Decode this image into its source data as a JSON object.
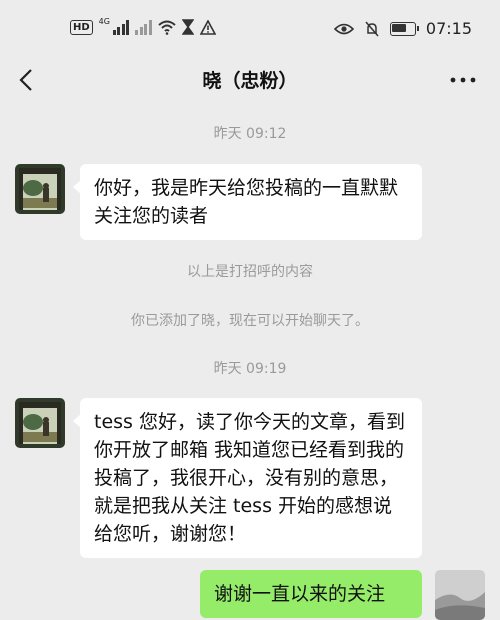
{
  "status_bar": {
    "hd_label": "HD",
    "network_label": "4G",
    "time": "07:15",
    "battery_level": 0.72
  },
  "header": {
    "title": "晓（忠粉）"
  },
  "messages": [
    {
      "type": "timestamp",
      "text": "昨天 09:12"
    },
    {
      "type": "incoming",
      "text": "你好，我是昨天给您投稿的一直默默关注您的读者"
    },
    {
      "type": "system",
      "text": "以上是打招呼的内容"
    },
    {
      "type": "system",
      "text": "你已添加了晓，现在可以开始聊天了。"
    },
    {
      "type": "timestamp",
      "text": "昨天 09:19"
    },
    {
      "type": "incoming",
      "text": "tess 您好，读了你今天的文章，看到你开放了邮箱 我知道您已经看到我的投稿了，我很开心，没有别的意思，就是把我从关注 tess 开始的感想说给您听，谢谢您！"
    },
    {
      "type": "outgoing",
      "text": "谢谢一直以来的关注"
    }
  ],
  "colors": {
    "background": "#ececec",
    "incoming_bubble": "#ffffff",
    "outgoing_bubble": "#95ec69",
    "meta_text": "#9a9a9a"
  }
}
